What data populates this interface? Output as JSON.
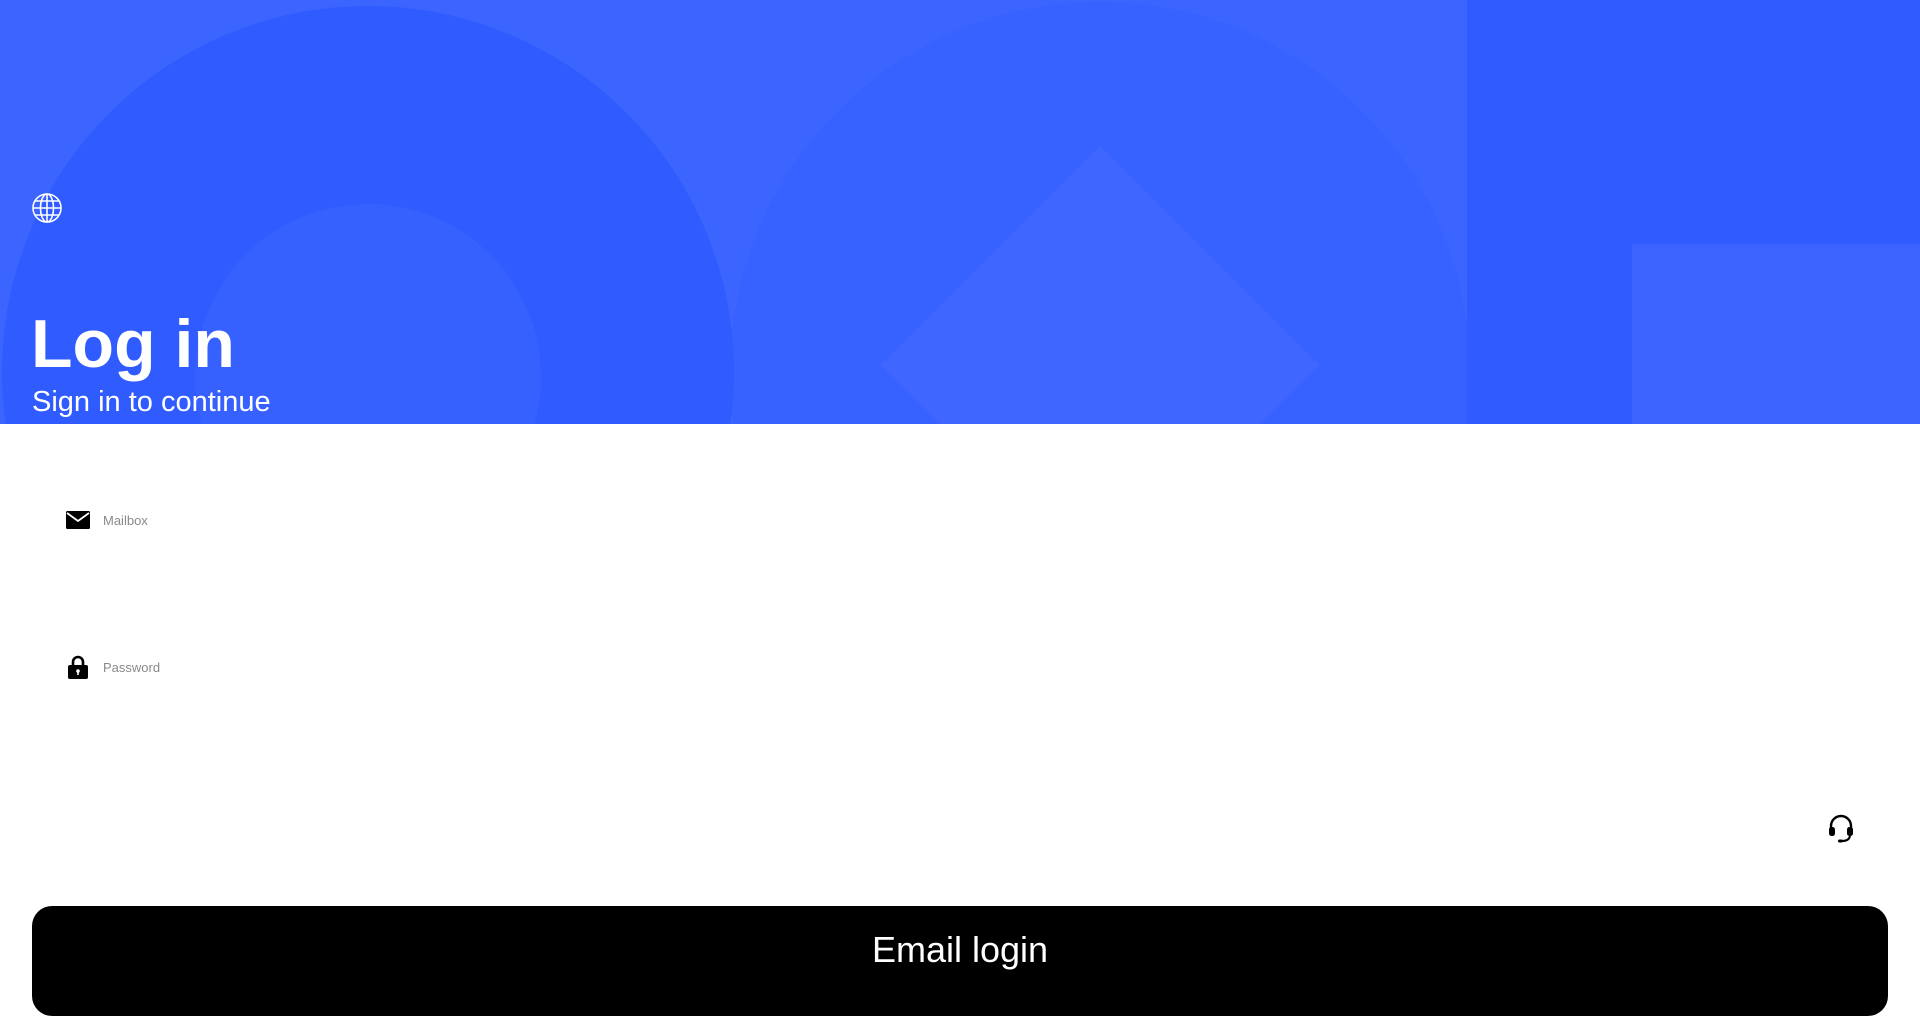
{
  "header": {
    "title": "Log in",
    "subtitle": "Sign in to continue",
    "language_icon": "globe-icon",
    "background_color": "#3c64fe"
  },
  "form": {
    "email": {
      "icon": "mail-icon",
      "placeholder": "Mailbox",
      "value": ""
    },
    "password": {
      "icon": "lock-icon",
      "placeholder": "Password",
      "value": ""
    }
  },
  "support": {
    "icon": "headset-icon"
  },
  "actions": {
    "login_label": "Email login",
    "login_color": "#000000"
  }
}
